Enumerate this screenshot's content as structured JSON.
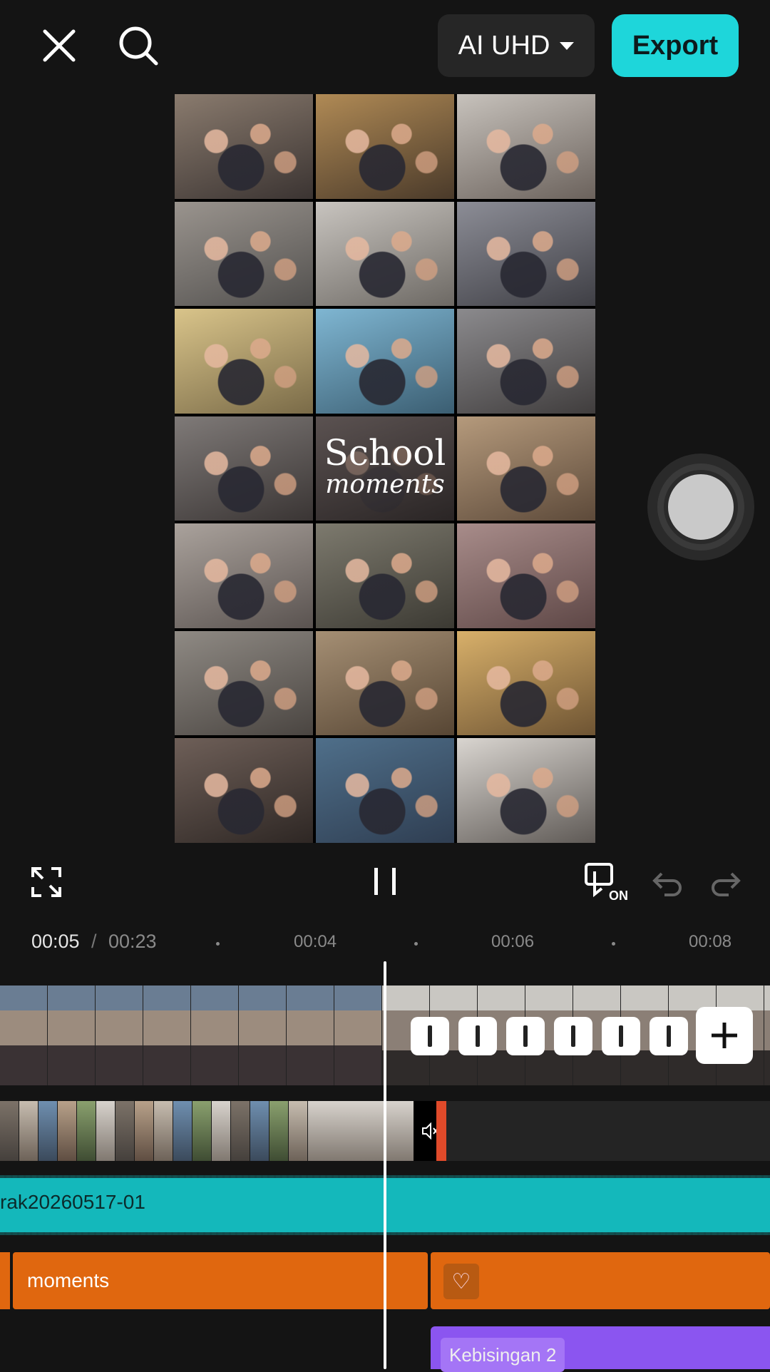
{
  "topbar": {
    "quality_label": "AI UHD",
    "export_label": "Export"
  },
  "preview": {
    "title_text": "School",
    "subtitle_text": "moments"
  },
  "controls": {
    "captions_toggle_text": "ON"
  },
  "timeline": {
    "current_time": "00:05",
    "separator": "/",
    "total_time": "00:23",
    "ticks": [
      "00:04",
      "00:06",
      "00:08"
    ],
    "audio_clip_label": "rak20260517-01",
    "text_clip_label": "moments",
    "heart_glyph": "♡",
    "effect_clip_label": "Kebisingan 2"
  },
  "colors": {
    "export": "#1ed6da",
    "audio_track": "#14b8bb",
    "text_track": "#e0670f",
    "effect_track": "#8b55f0"
  }
}
